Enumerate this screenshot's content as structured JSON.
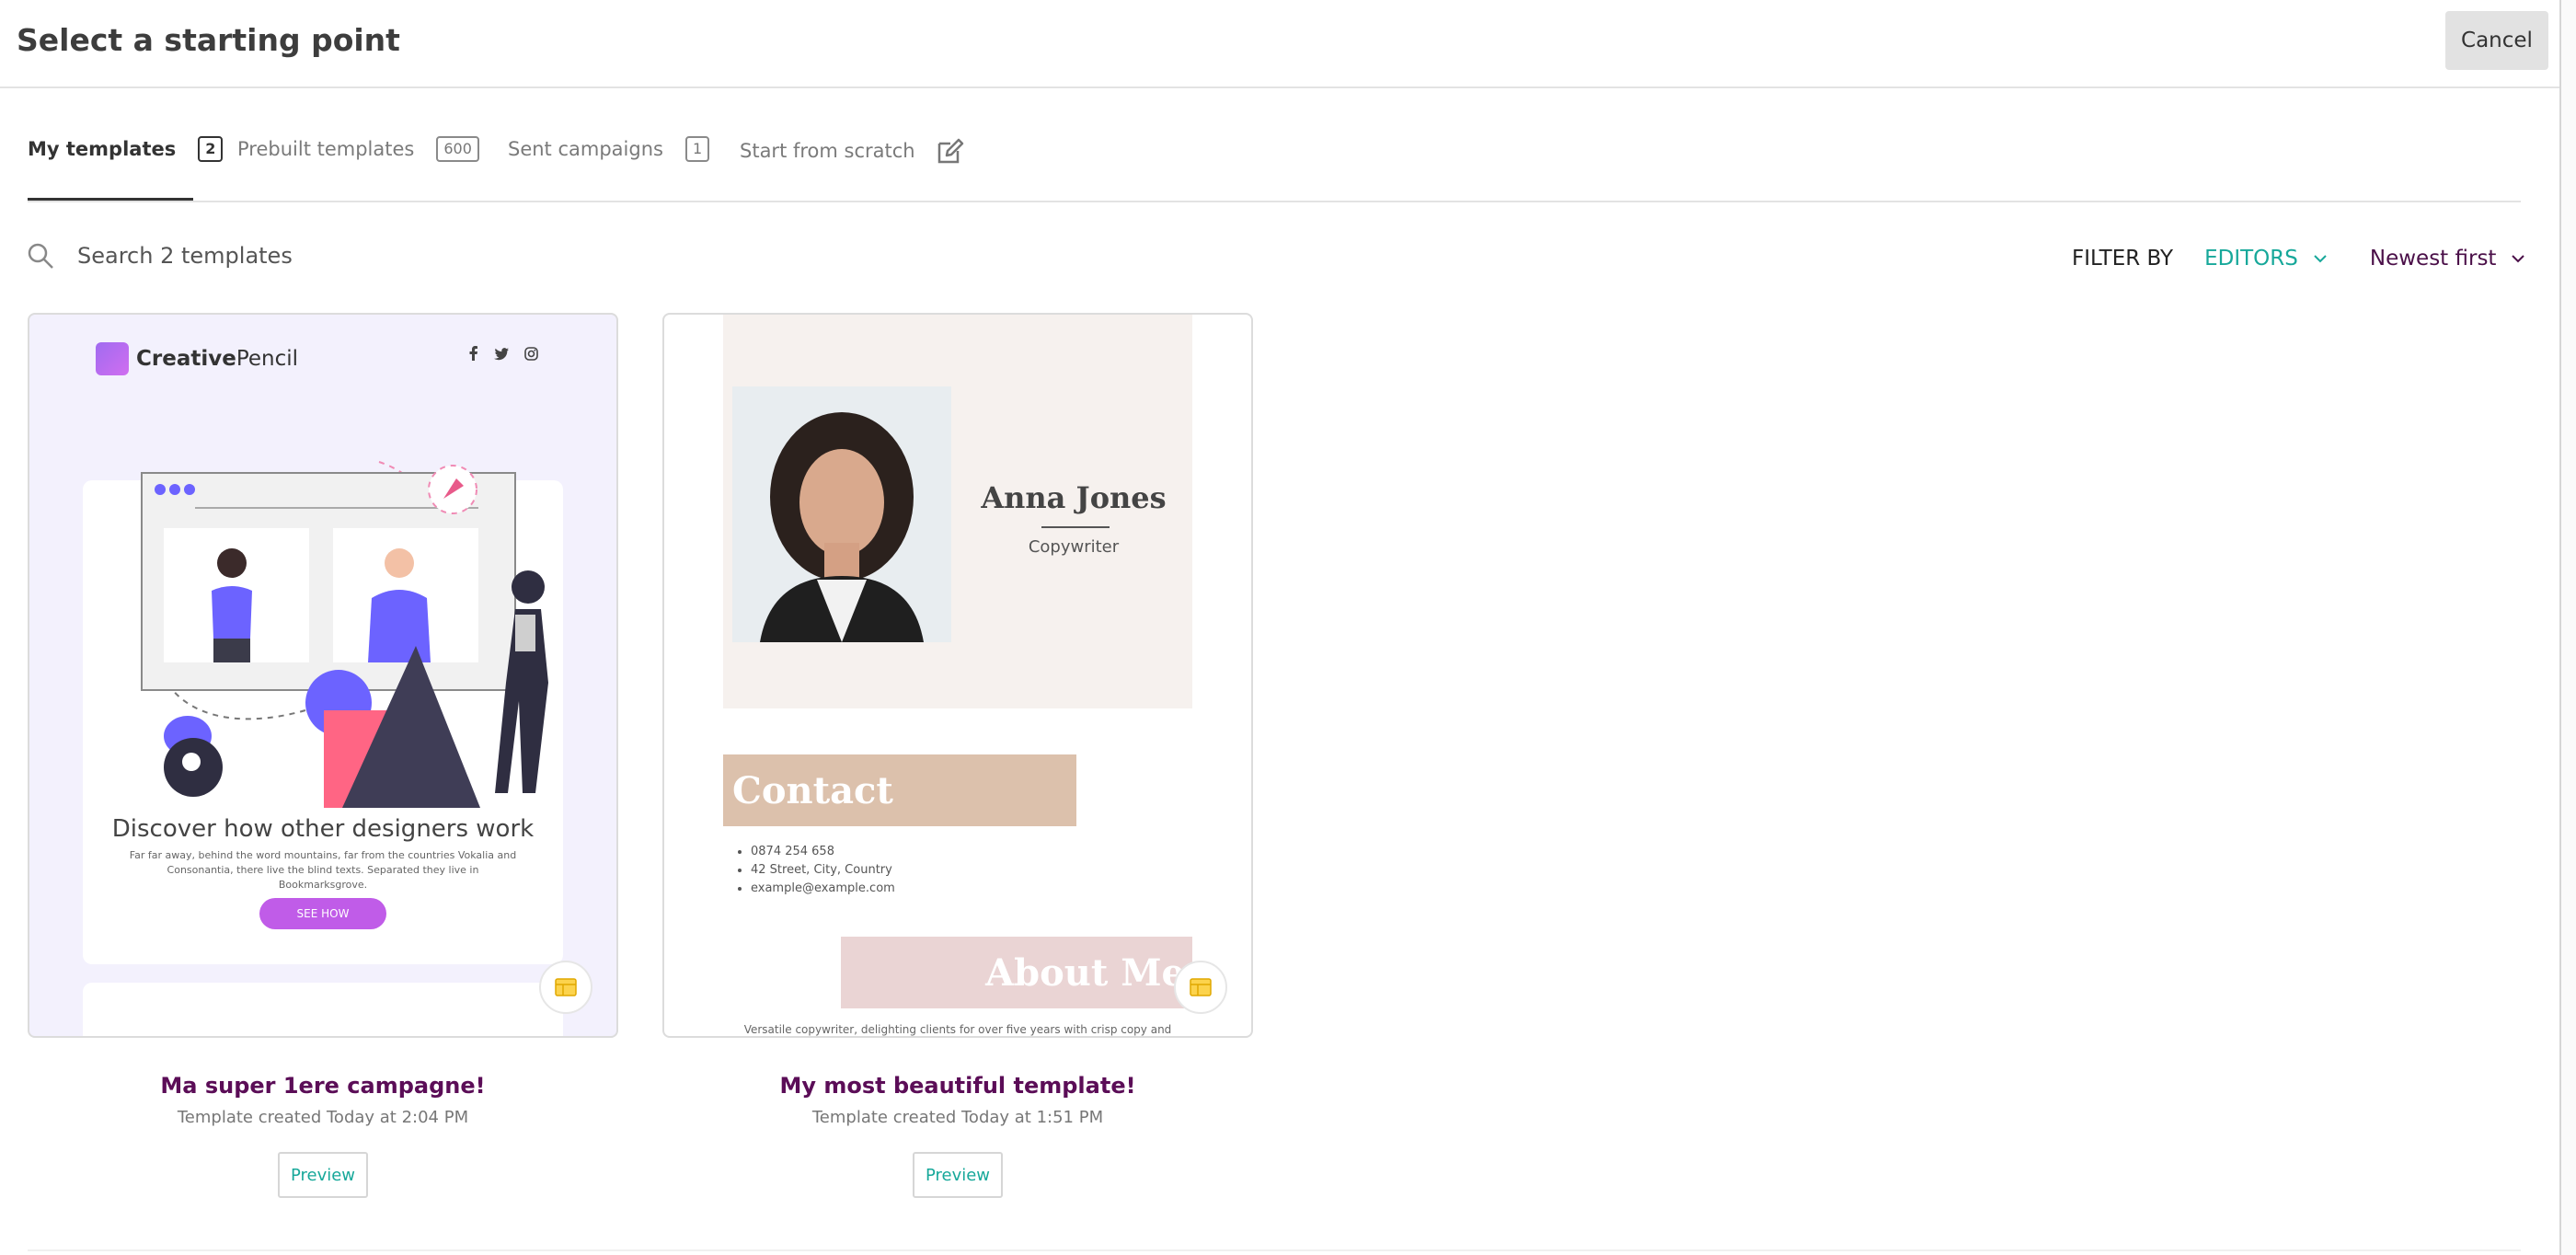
{
  "header": {
    "title": "Select a starting point",
    "cancel_label": "Cancel"
  },
  "tabs": [
    {
      "label": "My templates",
      "count": "2",
      "active": true
    },
    {
      "label": "Prebuilt templates",
      "count": "600",
      "active": false
    },
    {
      "label": "Sent campaigns",
      "count": "1",
      "active": false
    },
    {
      "label": "Start from scratch",
      "active": false
    }
  ],
  "search": {
    "placeholder": "Search 2 templates"
  },
  "filter": {
    "label": "FILTER BY",
    "editors": "EDITORS",
    "sort": "Newest first"
  },
  "colors": {
    "accent": "#17a89a",
    "title_purple": "#5b0d57",
    "sort_purple": "#4b1049"
  },
  "templates": [
    {
      "name": "Ma super 1ere campagne!",
      "subtitle": "Template created Today at 2:04 PM",
      "preview_label": "Preview",
      "thumb": {
        "brand_bold": "Creative",
        "brand_light": "Pencil",
        "social": "f • ◎",
        "headline": "Discover how other designers work",
        "body": "Far far away, behind the word mountains, far from the countries Vokalia and Consonantia, there live the blind texts. Separated they live in Bookmarksgrove.",
        "button": "SEE HOW"
      }
    },
    {
      "name": "My most beautiful template!",
      "subtitle": "Template created Today at 1:51 PM",
      "preview_label": "Preview",
      "thumb": {
        "name": "Anna Jones",
        "role": "Copywriter",
        "contact_heading": "Contact",
        "contact_items": [
          "0874 254 658",
          "42 Street, City, Country",
          "example@example.com"
        ],
        "about_heading": "About Me",
        "about_text": "Versatile copywriter, delighting clients for over five years with crisp copy and"
      }
    }
  ]
}
